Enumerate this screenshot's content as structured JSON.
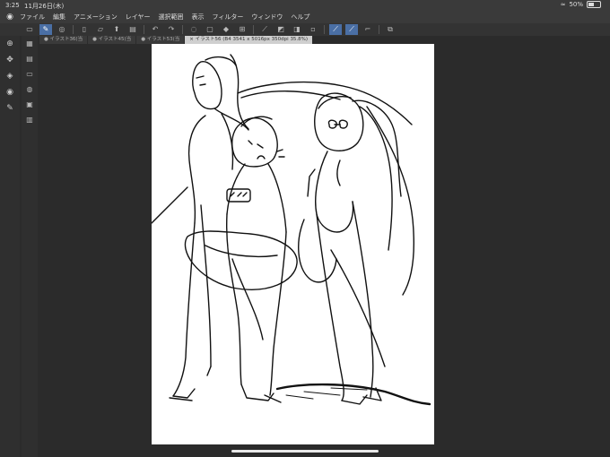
{
  "status": {
    "time": "3:25",
    "date": "11月26日(木)",
    "battery": "50%",
    "battery_level": 0.5
  },
  "menu": {
    "items": [
      "ファイル",
      "編集",
      "アニメーション",
      "レイヤー",
      "選択範囲",
      "表示",
      "フィルター",
      "ウィンドウ",
      "ヘルプ"
    ]
  },
  "tabs": [
    {
      "label": "● イラスト36(当"
    },
    {
      "label": "● イラスト45(当"
    },
    {
      "label": "● イラスト53(当"
    },
    {
      "label": "× イラスト56 (B4 3541 x 5016px 350dpi 35.8%)"
    }
  ],
  "colors": {
    "accent": "#4a6fa5",
    "canvas": "#ffffff",
    "background": "#2b2b2b"
  }
}
